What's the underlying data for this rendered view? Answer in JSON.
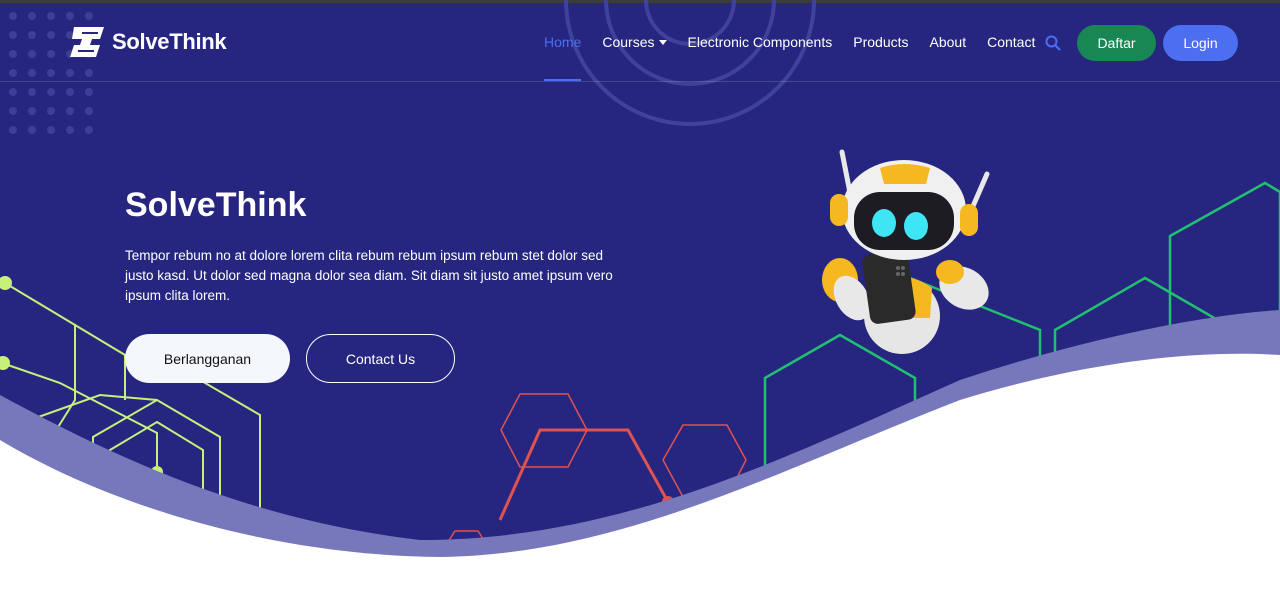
{
  "brand": {
    "name": "SolveThink",
    "logo_icon": "shield-logo"
  },
  "nav": {
    "home": "Home",
    "courses": "Courses",
    "electronic_components": "Electronic Components",
    "products": "Products",
    "about": "About",
    "contact": "Contact",
    "search_icon": "search-icon"
  },
  "actions": {
    "daftar": "Daftar",
    "login": "Login"
  },
  "hero": {
    "title": "SolveThink",
    "description": "Tempor rebum no at dolore lorem clita rebum rebum ipsum rebum stet dolor sed justo kasd. Ut dolor sed magna dolor sea diam. Sit diam sit justo amet ipsum vero ipsum clita lorem.",
    "subscribe_button": "Berlangganan",
    "contact_button": "Contact Us"
  },
  "colors": {
    "background": "#262680",
    "accent": "#4b6ff0",
    "daftar": "#198754",
    "hex_green": "#20c070",
    "hex_lime": "#c6f07a",
    "hex_red": "#e0524f"
  }
}
